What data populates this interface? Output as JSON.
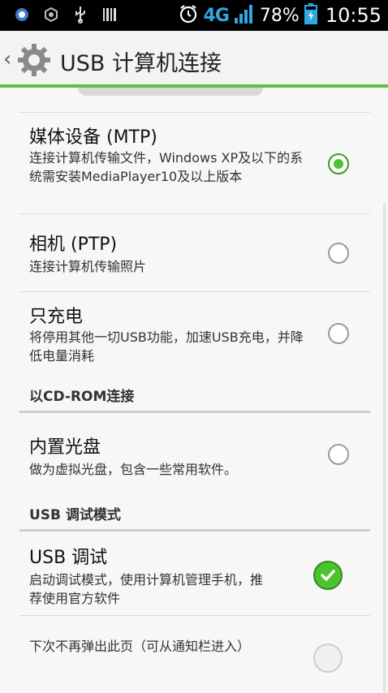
{
  "status_bar": {
    "network": "4G",
    "battery_percent": "78%",
    "time": "10:55"
  },
  "action_bar": {
    "title": "USB 计算机连接"
  },
  "items": [
    {
      "title": "媒体设备 (MTP)",
      "subtitle": "连接计算机传输文件，Windows XP及以下的系统需安装MediaPlayer10及以上版本",
      "selected": true
    },
    {
      "title": "相机 (PTP)",
      "subtitle": "连接计算机传输照片",
      "selected": false
    },
    {
      "title": "只充电",
      "subtitle": "将停用其他一切USB功能，加速USB充电，并降低电量消耗",
      "selected": false
    }
  ],
  "section_cdrom": {
    "label": "以CD-ROM连接"
  },
  "cdrom_item": {
    "title": "内置光盘",
    "subtitle": "做为虚拟光盘，包含一些常用软件。",
    "selected": false
  },
  "section_usb_debug": {
    "label": "USB 调试模式"
  },
  "usb_debug_item": {
    "title": "USB 调试",
    "subtitle": "启动调试模式，使用计算机管理手机，推荐使用官方软件",
    "checked": true
  },
  "no_popup_item": {
    "subtitle": "下次不再弹出此页（可从通知栏进入）",
    "checked": false
  },
  "colors": {
    "accent": "#4cc22f",
    "network": "#2fa8e0"
  }
}
